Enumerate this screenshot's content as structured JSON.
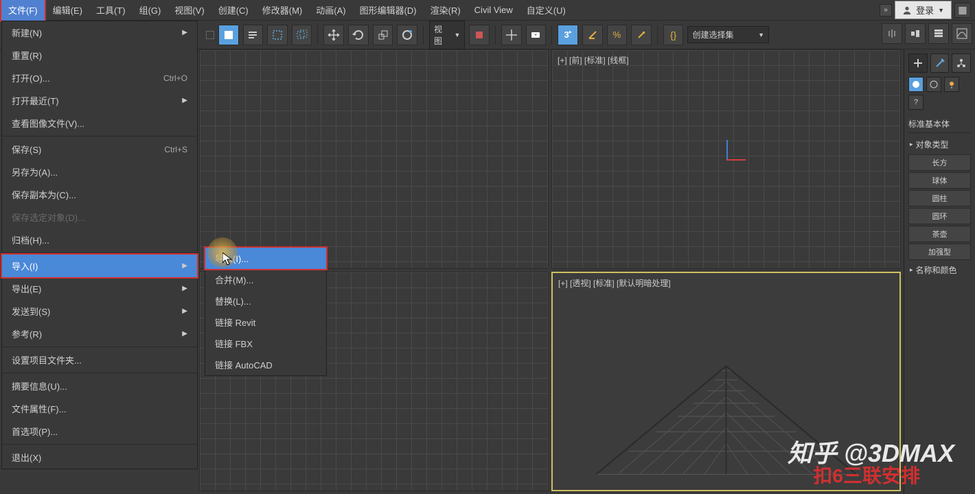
{
  "menubar": {
    "items": [
      "文件(F)",
      "编辑(E)",
      "工具(T)",
      "组(G)",
      "视图(V)",
      "创建(C)",
      "修改器(M)",
      "动画(A)",
      "图形编辑器(D)",
      "渲染(R)",
      "Civil View",
      "自定义(U)"
    ],
    "login": "登录"
  },
  "toolbar": {
    "view_dropdown": "视图",
    "selset_label": "创建选择集"
  },
  "file_menu": {
    "items": [
      {
        "label": "新建(N)",
        "arrow": true
      },
      {
        "label": "重置(R)"
      },
      {
        "label": "打开(O)...",
        "shortcut": "Ctrl+O"
      },
      {
        "label": "打开最近(T)",
        "arrow": true
      },
      {
        "label": "查看图像文件(V)..."
      },
      {
        "sep": true
      },
      {
        "label": "保存(S)",
        "shortcut": "Ctrl+S"
      },
      {
        "label": "另存为(A)..."
      },
      {
        "label": "保存副本为(C)..."
      },
      {
        "label": "保存选定对象(D)...",
        "disabled": true
      },
      {
        "label": "归档(H)..."
      },
      {
        "sep": true
      },
      {
        "label": "导入(I)",
        "arrow": true,
        "highlighted": true
      },
      {
        "label": "导出(E)",
        "arrow": true
      },
      {
        "label": "发送到(S)",
        "arrow": true
      },
      {
        "label": "参考(R)",
        "arrow": true
      },
      {
        "sep": true
      },
      {
        "label": "设置项目文件夹..."
      },
      {
        "sep": true
      },
      {
        "label": "摘要信息(U)..."
      },
      {
        "label": "文件属性(F)..."
      },
      {
        "label": "首选项(P)..."
      },
      {
        "sep": true
      },
      {
        "label": "退出(X)"
      }
    ]
  },
  "sub_menu": {
    "items": [
      {
        "label": "导入(I)...",
        "highlighted": true
      },
      {
        "label": "合并(M)..."
      },
      {
        "label": "替换(L)..."
      },
      {
        "label": "链接 Revit"
      },
      {
        "label": "链接 FBX"
      },
      {
        "label": "链接 AutoCAD"
      }
    ]
  },
  "viewports": {
    "top_right_label": "[+] [前] [标准] [线框]",
    "bottom_right_label": "[+] [透视] [标准] [默认明暗处理]"
  },
  "right_panel": {
    "primitive_label": "标准基本体",
    "object_type_label": "对象类型",
    "name_color_label": "名称和颜色",
    "buttons": [
      "长方",
      "球体",
      "圆柱",
      "圆环",
      "茶壶",
      "加强型"
    ]
  },
  "watermark": {
    "line1": "知乎 @3DMAX",
    "line2": "扣6三联安排"
  }
}
